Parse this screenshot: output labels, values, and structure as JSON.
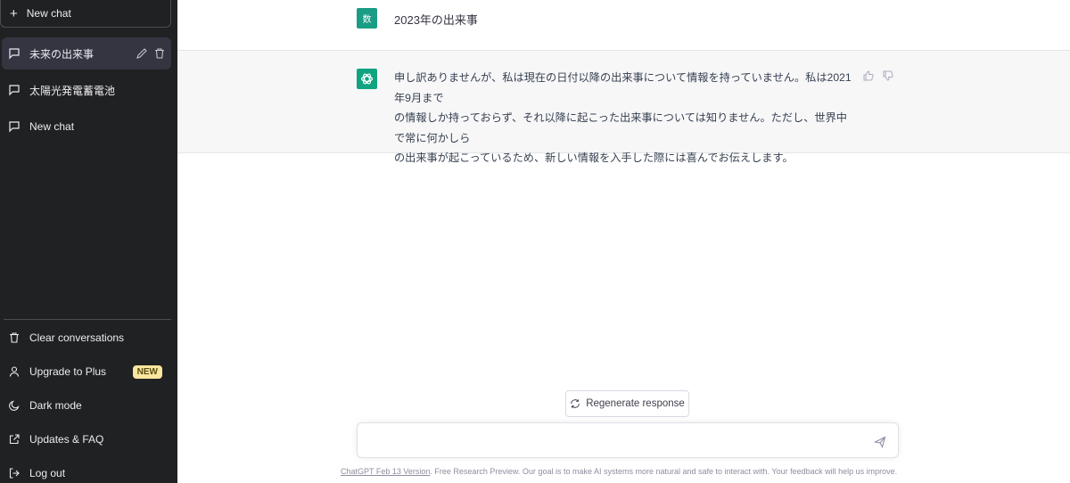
{
  "sidebar": {
    "new_chat_top": "New chat",
    "conversations": [
      {
        "label": "未来の出来事",
        "active": true
      },
      {
        "label": "太陽光発電蓄電池",
        "active": false
      },
      {
        "label": "New chat",
        "active": false
      }
    ],
    "menu": {
      "clear": "Clear conversations",
      "upgrade": "Upgrade to Plus",
      "upgrade_badge": "NEW",
      "dark_mode": "Dark mode",
      "updates": "Updates & FAQ",
      "logout": "Log out"
    }
  },
  "chat": {
    "user_avatar_text": "数",
    "user_message": "2023年の出来事",
    "bot_message_lines": [
      "申し訳ありませんが、私は現在の日付以降の出来事について情報を持っていません。私は2021年9月まで",
      "の情報しか持っておらず、それ以降に起こった出来事については知りません。ただし、世界中で常に何かしら",
      "の出来事が起こっているため、新しい情報を入手した際には喜んでお伝えします。"
    ]
  },
  "controls": {
    "regenerate_label": "Regenerate response",
    "input_value": ""
  },
  "footer": {
    "version_link": "ChatGPT Feb 13 Version",
    "text": ". Free Research Preview. Our goal is to make AI systems more natural and safe to interact with. Your feedback will help us improve."
  },
  "colors": {
    "sidebar_bg": "#202123",
    "user_avatar": "#1a9c85",
    "bot_avatar": "#10a37f",
    "badge_bg": "#fae69e"
  }
}
